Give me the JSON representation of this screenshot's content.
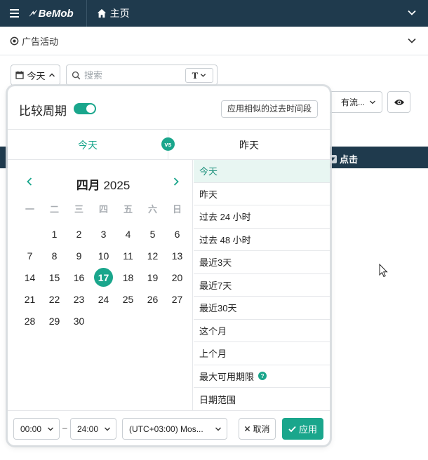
{
  "topbar": {
    "logo_text": "BeMob",
    "home_label": "主页"
  },
  "subbar": {
    "section_label": "广告活动"
  },
  "filters": {
    "date_label": "今天",
    "search_placeholder": "搜索",
    "text_type_label": "T",
    "traffic_label": "有流..."
  },
  "table": {
    "clicks_header": "点击"
  },
  "compare": {
    "title": "比较周期",
    "toggle_on": true,
    "apply_similar_label": "应用相似的过去时间段",
    "tab_current": "今天",
    "vs_label": "vs",
    "tab_compare": "昨天"
  },
  "calendar": {
    "month": "四月",
    "year": "2025",
    "weekdays": [
      "一",
      "二",
      "三",
      "四",
      "五",
      "六",
      "日"
    ],
    "leading_blanks": 1,
    "days": [
      "1",
      "2",
      "3",
      "4",
      "5",
      "6",
      "7",
      "8",
      "9",
      "10",
      "11",
      "12",
      "13",
      "14",
      "15",
      "16",
      "17",
      "18",
      "19",
      "20",
      "21",
      "22",
      "23",
      "24",
      "25",
      "26",
      "27",
      "28",
      "29",
      "30"
    ],
    "selected_day": "17"
  },
  "presets": {
    "items": [
      "今天",
      "昨天",
      "过去 24 小时",
      "过去 48 小时",
      "最近3天",
      "最近7天",
      "最近30天",
      "这个月",
      "上个月",
      "最大可用期限",
      "日期范围"
    ],
    "active": "今天",
    "help_item": "最大可用期限",
    "help_glyph": "?"
  },
  "footer": {
    "from_time": "00:00",
    "separator": "–",
    "to_time": "24:00",
    "timezone": "(UTC+03:00) Mos...",
    "cancel_label": "取消",
    "apply_label": "应用"
  },
  "colors": {
    "accent": "#1aa68c",
    "header_bg": "#1f3a4d",
    "active_row_bg": "#e8f6f2"
  }
}
